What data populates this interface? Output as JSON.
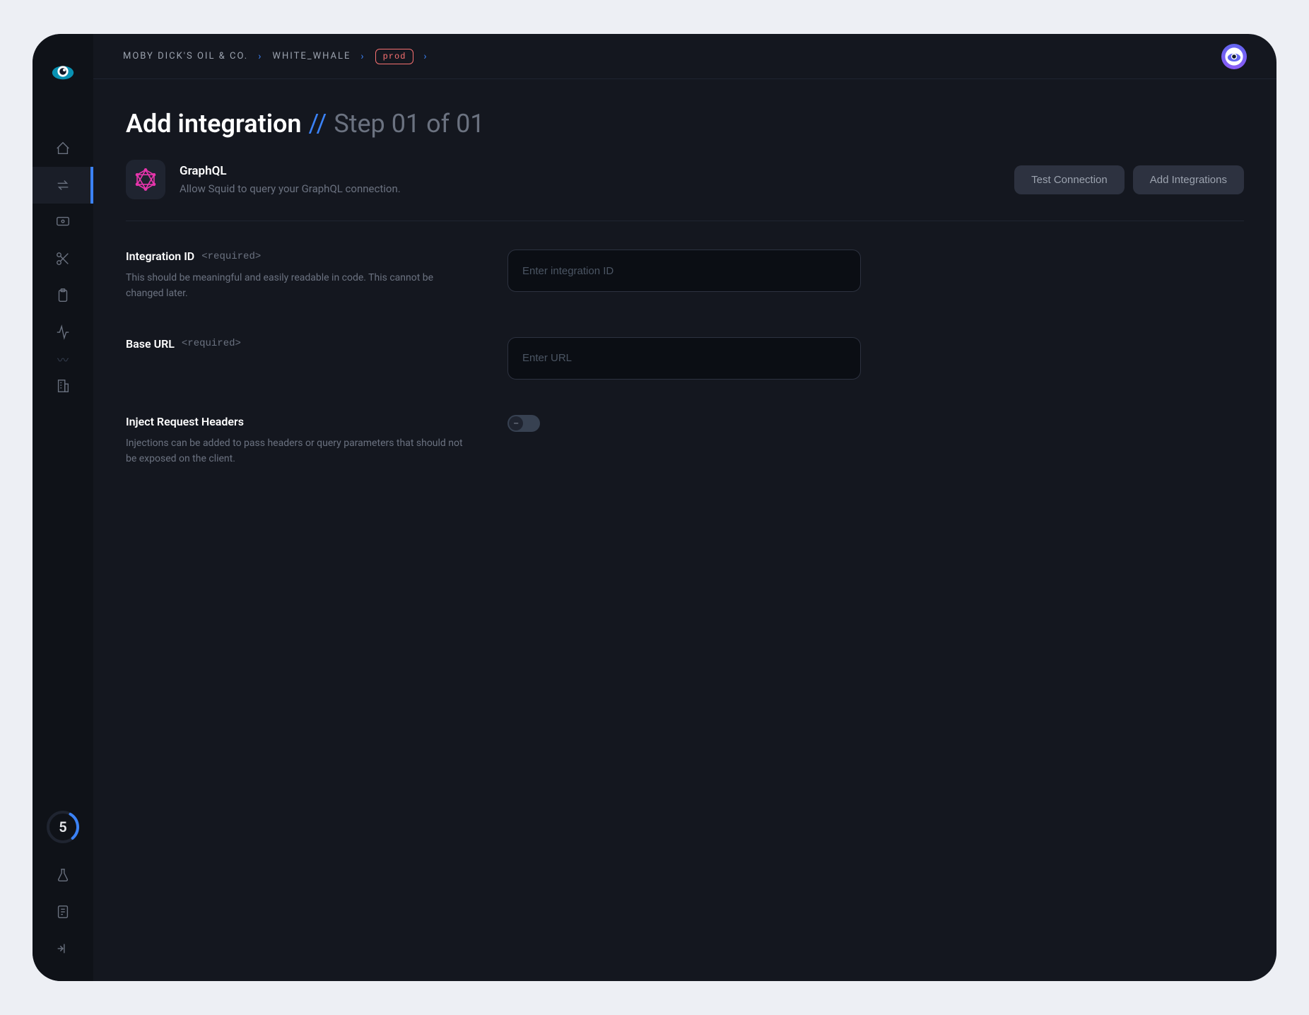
{
  "breadcrumb": {
    "org": "MOBY DICK'S OIL & CO.",
    "project": "WHITE_WHALE",
    "env": "prod"
  },
  "page": {
    "title": "Add integration",
    "separator": "//",
    "step": "Step 01 of 01"
  },
  "integration": {
    "name": "GraphQL",
    "description": "Allow Squid to query your GraphQL connection."
  },
  "actions": {
    "test": "Test Connection",
    "add": "Add Integrations"
  },
  "fields": {
    "integrationId": {
      "label": "Integration ID",
      "required": "<required>",
      "help": "This should be meaningful and easily readable in code. This cannot be changed later.",
      "placeholder": "Enter integration ID"
    },
    "baseUrl": {
      "label": "Base URL",
      "required": "<required>",
      "placeholder": "Enter URL"
    },
    "injectHeaders": {
      "label": "Inject Request Headers",
      "help": "Injections can be added to pass headers or query parameters that should not be exposed on the client."
    }
  },
  "sidebar": {
    "progress": "5"
  }
}
